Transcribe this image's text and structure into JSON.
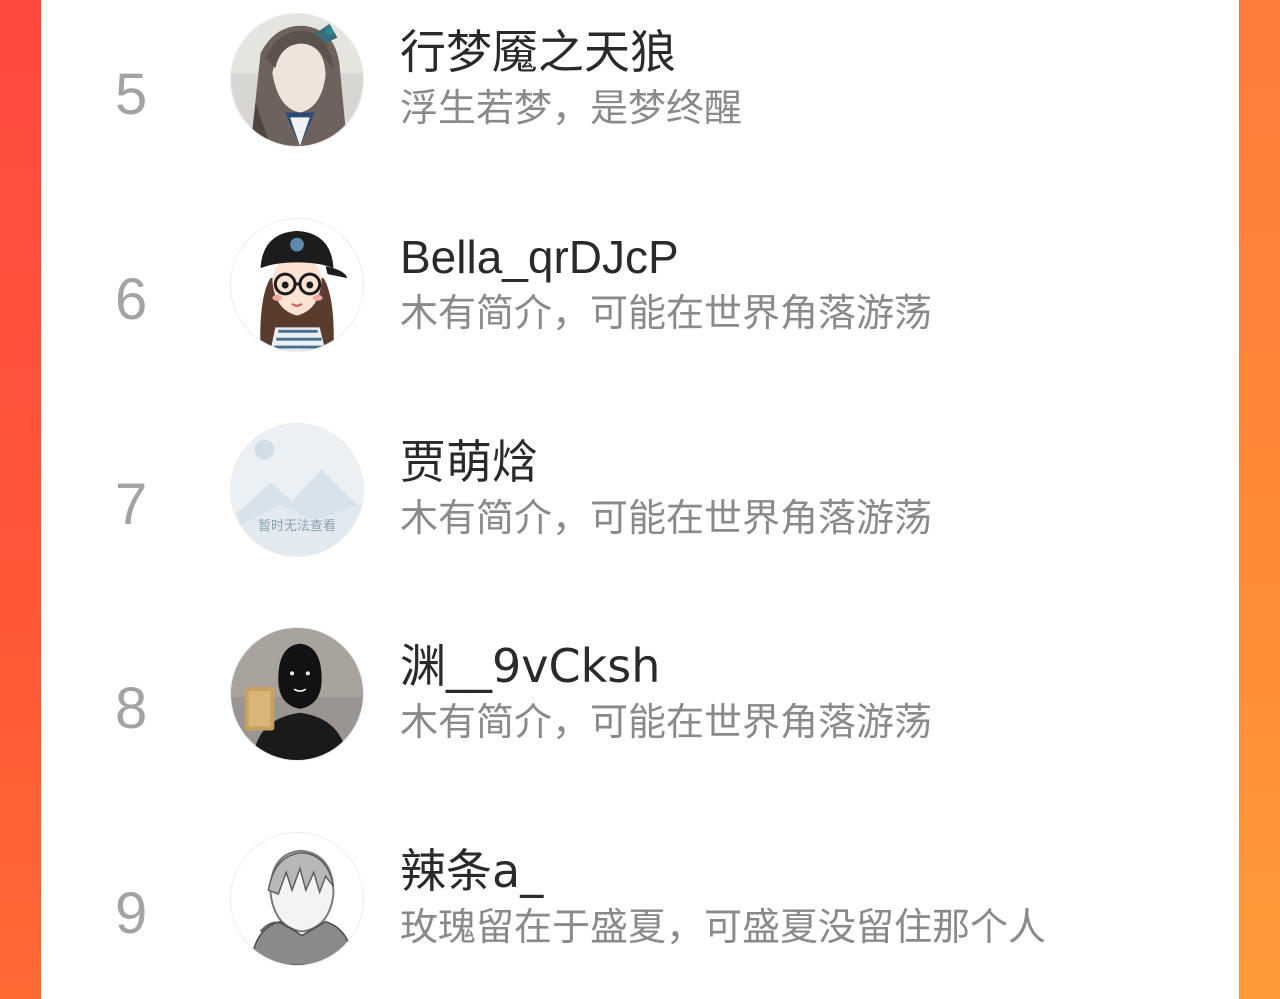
{
  "leaderboard": {
    "entries": [
      {
        "rank": "5",
        "name": "行梦魇之天狼",
        "bio": "浮生若梦，是梦终醒",
        "avatar": "anime-character-avatar"
      },
      {
        "rank": "6",
        "name": "Bella_qrDJcP",
        "bio": "木有简介，可能在世界角落游荡",
        "avatar": "cartoon-girl-cap-avatar"
      },
      {
        "rank": "7",
        "name": "贾萌焓",
        "bio": "木有简介，可能在世界角落游荡",
        "avatar": "image-unavailable-placeholder",
        "placeholder_text": "暂时无法查看"
      },
      {
        "rank": "8",
        "name": "渊__9vCksh",
        "bio": "木有简介，可能在世界角落游荡",
        "avatar": "dark-silhouette-avatar"
      },
      {
        "rank": "9",
        "name": "辣条a_",
        "bio": "玫瑰留在于盛夏，可盛夏没留住那个人",
        "avatar": "sketch-character-avatar"
      }
    ]
  },
  "colors": {
    "background_gradient_left": "#ff4d3d",
    "background_gradient_right": "#ff8a36",
    "card": "#ffffff",
    "rank_text": "#a3a3a3",
    "name_text": "#2a2a2a",
    "bio_text": "#8a8a8a"
  }
}
